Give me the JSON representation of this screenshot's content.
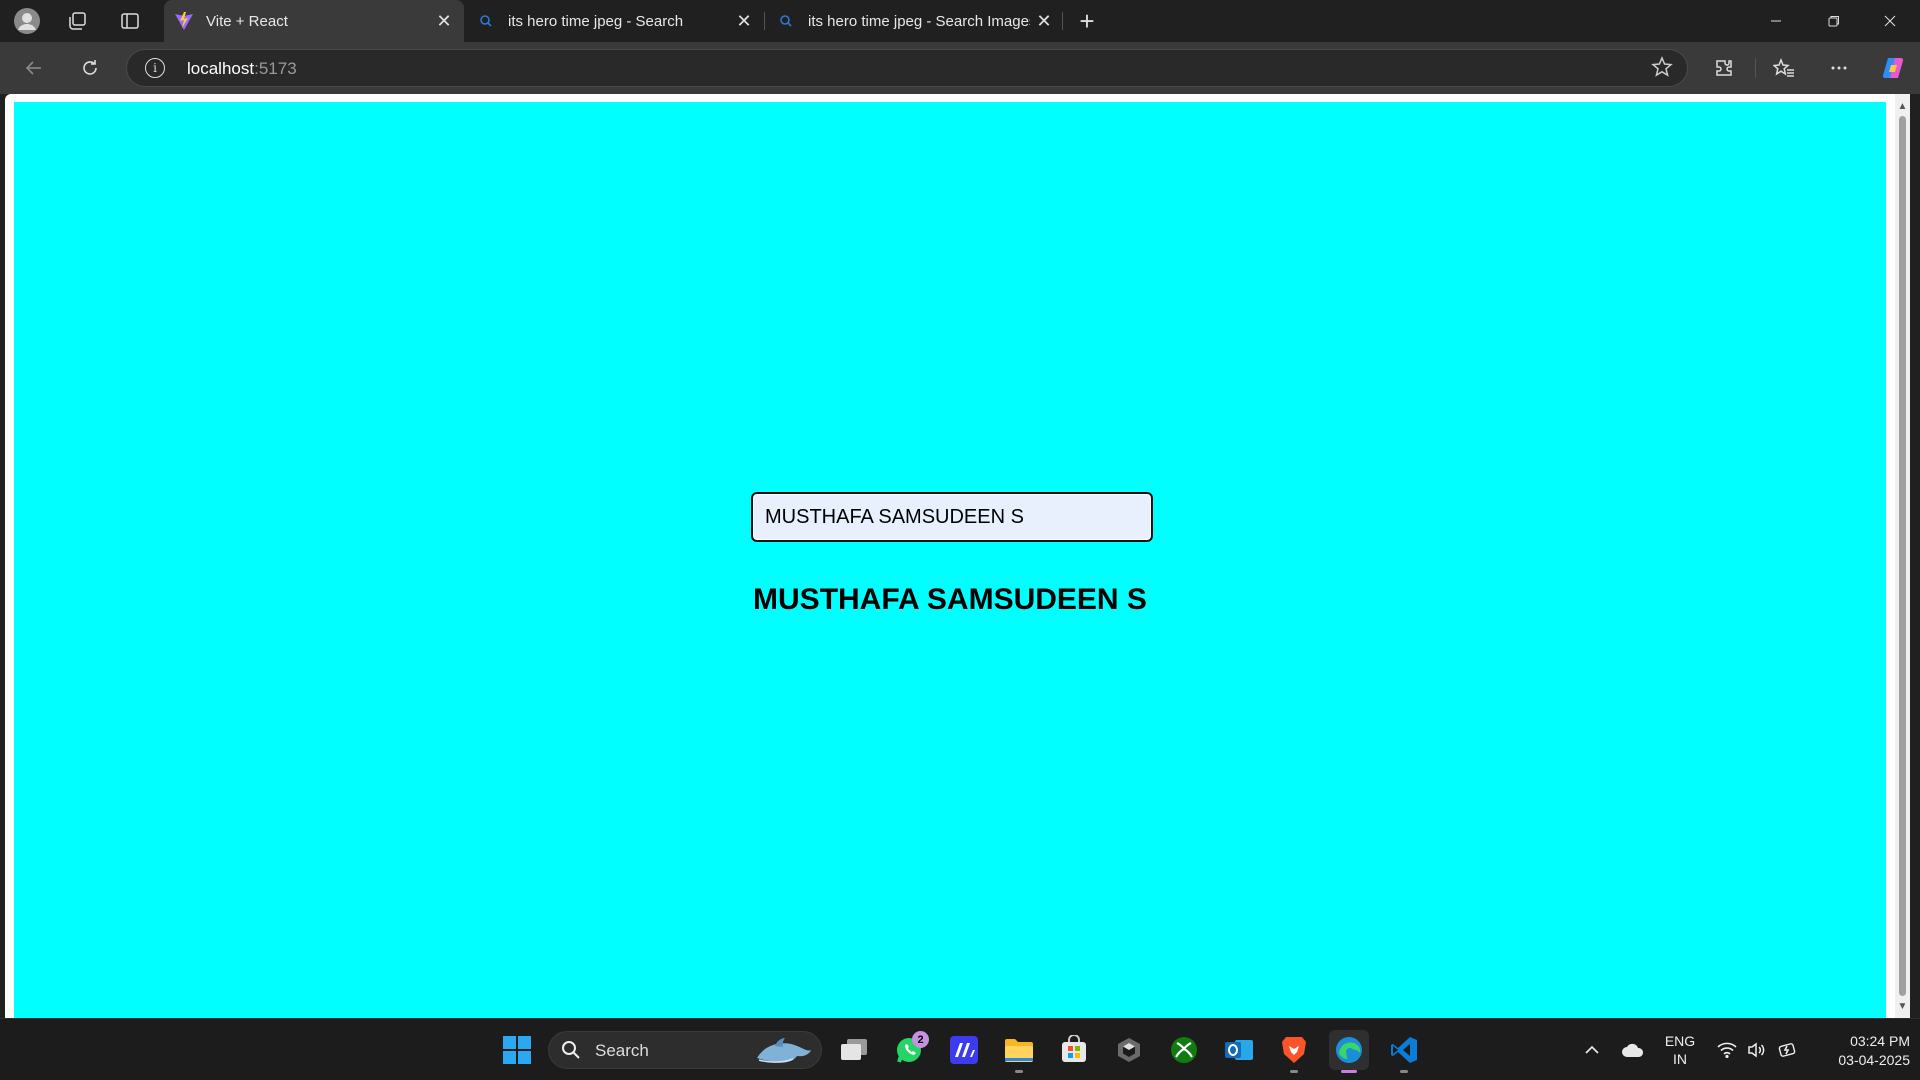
{
  "browser": {
    "tabs": [
      {
        "title": "Vite + React",
        "active": true
      },
      {
        "title": "its hero time jpeg - Search",
        "active": false
      },
      {
        "title": "its hero time jpeg - Search Images",
        "active": false
      }
    ],
    "close_glyph": "✕",
    "new_tab_glyph": "+",
    "url_host": "localhost",
    "url_port": ":5173"
  },
  "page": {
    "background": "#00ffff",
    "input_value": "MUSTHAFA SAMSUDEEN S",
    "heading": "MUSTHAFA SAMSUDEEN S"
  },
  "taskbar": {
    "search_label": "Search",
    "whatsapp_badge": "2",
    "language_line1": "ENG",
    "language_line2": "IN",
    "time": "03:24 PM",
    "date": "03-04-2025"
  },
  "colors": {
    "accent_active_app": "#c97ee0",
    "browser_chrome": "#202020",
    "toolbar": "#3a3a3a"
  }
}
